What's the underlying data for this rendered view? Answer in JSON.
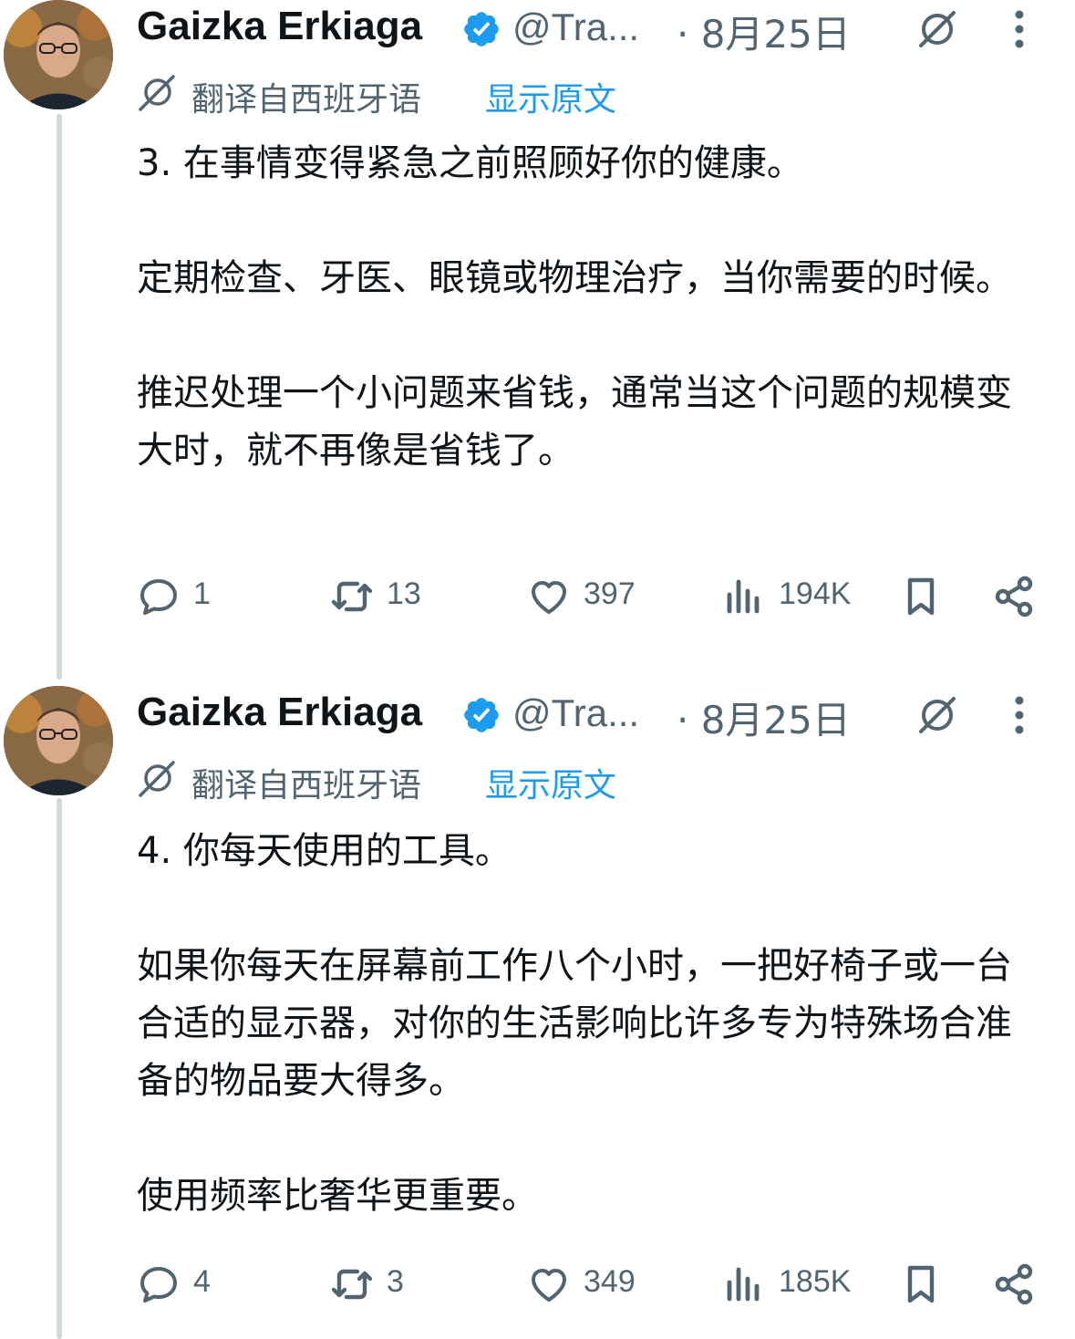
{
  "tweets": [
    {
      "author_name": "Gaizka Erkiaga",
      "handle": "@Tra...",
      "date": "· 8月25日",
      "translate_label": "翻译自西班牙语",
      "show_original": "显示原文",
      "body": "3. 在事情变得紧急之前照顾好你的健康。\n\n定期检查、牙医、眼镜或物理治疗，当你需要的时候。\n\n推迟处理一个小问题来省钱，通常当这个问题的规模变大时，就不再像是省钱了。",
      "replies": "1",
      "retweets": "13",
      "likes": "397",
      "views": "194K"
    },
    {
      "author_name": "Gaizka Erkiaga",
      "handle": "@Tra...",
      "date": "· 8月25日",
      "translate_label": "翻译自西班牙语",
      "show_original": "显示原文",
      "body": "4. 你每天使用的工具。\n\n如果你每天在屏幕前工作八个小时，一把好椅子或一台合适的显示器，对你的生活影响比许多专为特殊场合准备的物品要大得多。\n\n使用频率比奢华更重要。",
      "replies": "4",
      "retweets": "3",
      "likes": "349",
      "views": "185K"
    }
  ],
  "icons": {
    "verified": "verified-badge-icon",
    "grok": "grok-icon",
    "more": "more-vertical-icon",
    "translate": "translate-icon",
    "reply": "reply-icon",
    "retweet": "retweet-icon",
    "like": "heart-icon",
    "views": "views-icon",
    "bookmark": "bookmark-icon",
    "share": "share-icon"
  },
  "colors": {
    "text": "#0f1419",
    "secondary": "#536471",
    "accent": "#1d9bf0",
    "thread_line": "#cfd9de"
  }
}
